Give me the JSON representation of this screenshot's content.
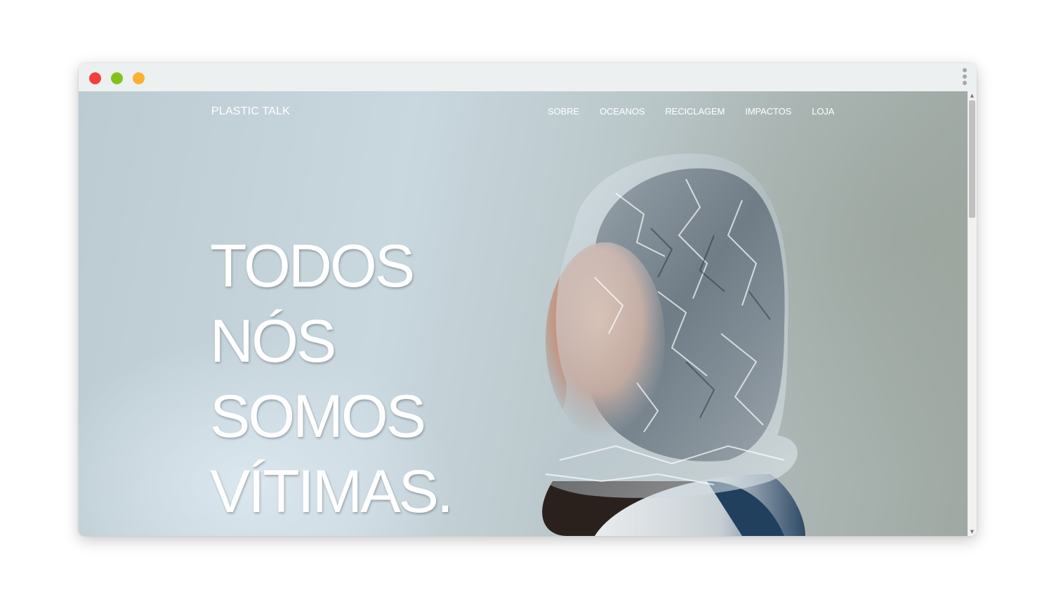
{
  "site": {
    "brand": "PLASTIC TALK",
    "nav": [
      "SOBRE",
      "OCEANOS",
      "RECICLAGEM",
      "IMPACTOS",
      "LOJA"
    ]
  },
  "hero": {
    "lines": [
      "TODOS",
      "NÓS",
      "SOMOS",
      "VÍTIMAS."
    ]
  },
  "colors": {
    "close": "#f33f3b",
    "minimize": "#84c21a",
    "maximize": "#fbb032",
    "titlebar": "#ecf0f1"
  },
  "icons": {
    "window_menu": "kebab-vertical-icon",
    "scroll_up": "triangle-up-icon",
    "scroll_down": "triangle-down-icon"
  },
  "image": {
    "subject": "person-with-plastic-bag-over-head"
  }
}
